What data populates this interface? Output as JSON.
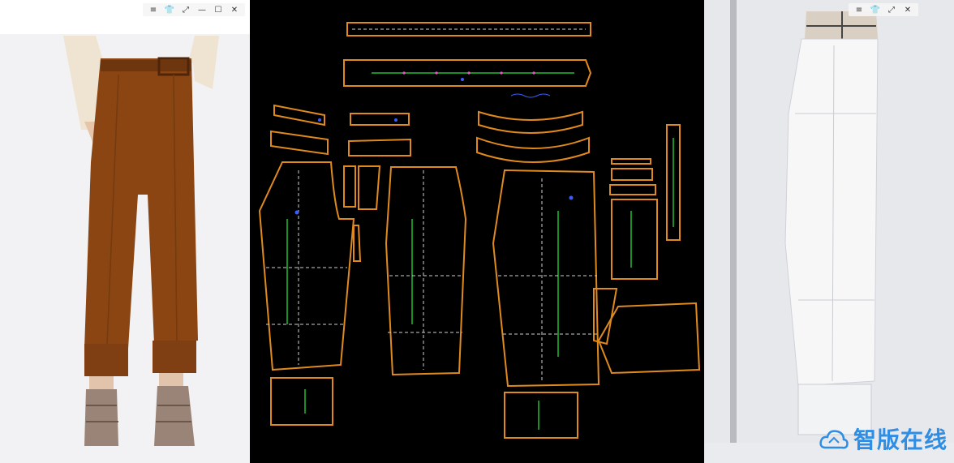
{
  "window_controls": {
    "menu_icon": "≡",
    "shirt_icon": "👕",
    "expand_icon": "⤢",
    "minimize_icon": "—",
    "maximize_icon": "☐",
    "close_icon": "✕"
  },
  "watermark": {
    "text": "智版在线",
    "color": "#2f8de4"
  },
  "colors": {
    "pattern_outline": "#e08a1e",
    "grain_line": "#20c030",
    "annotation": "#3a5cff",
    "garment": "#8a4513"
  }
}
